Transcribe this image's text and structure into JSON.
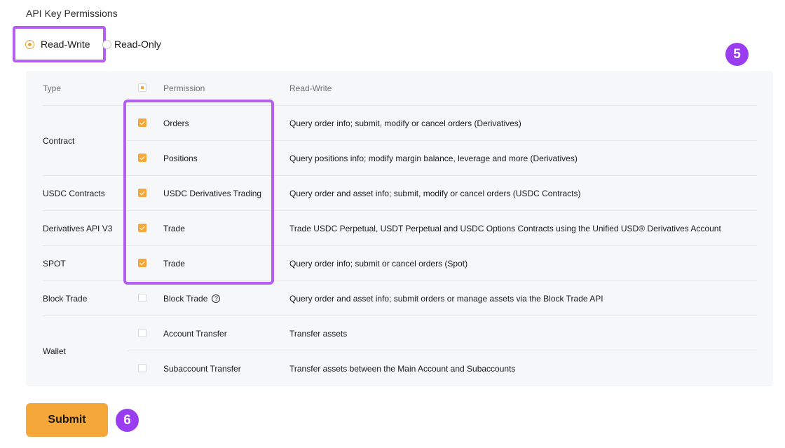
{
  "section_title": "API Key Permissions",
  "modes": [
    {
      "label": "Read-Write",
      "selected": true
    },
    {
      "label": "Read-Only",
      "selected": false
    }
  ],
  "step_badges": [
    "5",
    "6"
  ],
  "table": {
    "headers": {
      "type": "Type",
      "permission": "Permission",
      "mode": "Read-Write"
    },
    "types": [
      "Contract",
      "USDC Contracts",
      "Derivatives API V3",
      "SPOT",
      "Block Trade",
      "Wallet"
    ],
    "rows": [
      {
        "permission": "Orders",
        "description": "Query order info; submit, modify or cancel orders (Derivatives)",
        "checked": true
      },
      {
        "permission": "Positions",
        "description": "Query positions info; modify margin balance, leverage and more (Derivatives)",
        "checked": true
      },
      {
        "permission": "USDC Derivatives Trading",
        "description": "Query order and asset info; submit, modify or cancel orders (USDC Contracts)",
        "checked": true
      },
      {
        "permission": "Trade",
        "description": "Trade USDC Perpetual, USDT Perpetual and USDC Options Contracts using the Unified USD® Derivatives Account",
        "checked": true
      },
      {
        "permission": "Trade",
        "description": "Query order info; submit or cancel orders (Spot)",
        "checked": true
      },
      {
        "permission": "Block Trade",
        "description": "Query order and asset info; submit orders or manage assets via the Block Trade API",
        "checked": false
      },
      {
        "permission": "Account Transfer",
        "description": "Transfer assets",
        "checked": false
      },
      {
        "permission": "Subaccount Transfer",
        "description": "Transfer assets between the Main Account and Subaccounts",
        "checked": false
      }
    ]
  },
  "submit_label": "Submit",
  "colors": {
    "accent": "#f6a739",
    "highlight": "#b45ff2",
    "badge": "#9a3cf0"
  }
}
